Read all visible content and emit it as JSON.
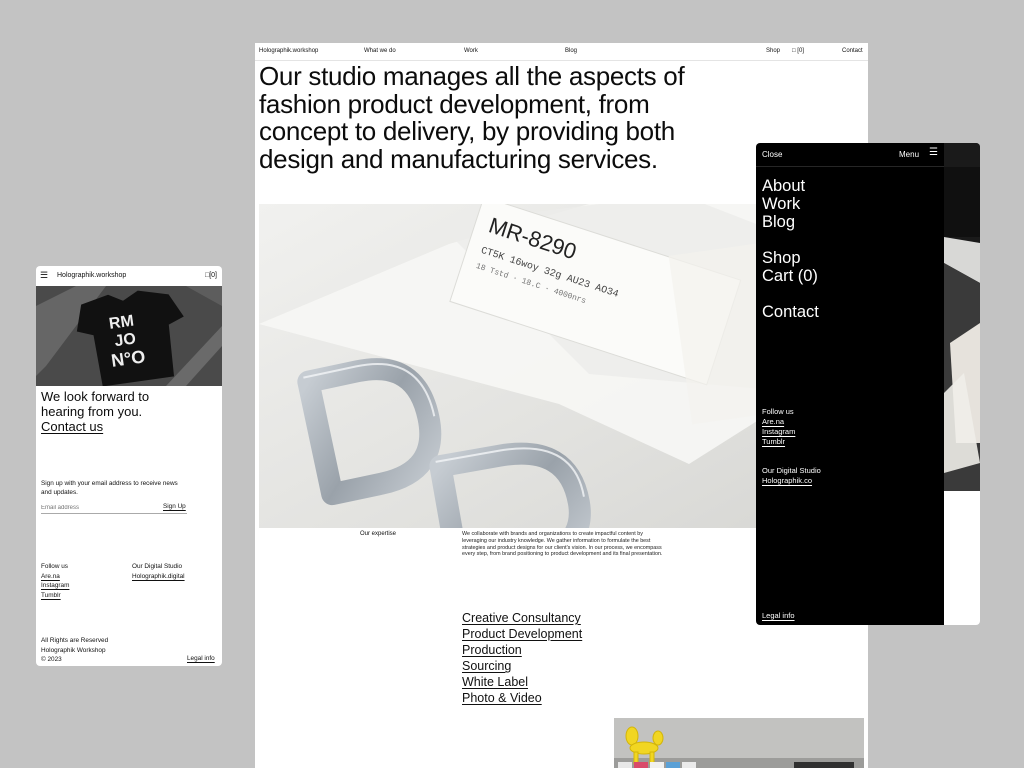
{
  "desktop": {
    "nav": {
      "brand": "Holographik.workshop",
      "what_we_do": "What we do",
      "work": "Work",
      "blog": "Blog",
      "shop": "Shop",
      "cart": "[0]",
      "contact": "Contact"
    },
    "hero_text": "Our studio manages all the aspects of fashion product development, from concept to delivery, by providing both design and manufacturing services.",
    "image_label_top": "MR-8290",
    "expertise": {
      "label": "Our expertise",
      "text": "We collaborate with brands and organizations to create impactful content by leveraging our industry knowledge. We gather information to formulate the best strategies and product designs for our client's vision. In our process, we encompass every step, from brand positioning to product development and its final presentation."
    },
    "services": [
      "Creative Consultancy",
      "Product Development",
      "Production",
      "Sourcing",
      "White Label",
      "Photo & Video"
    ]
  },
  "mobile": {
    "brand": "Holographik.workshop",
    "cart": "[0]",
    "headline_line1": "We look forward to",
    "headline_line2": "hearing from you.",
    "contact_link": "Contact us",
    "signup_text": "Sign up with your email address to receive news and updates.",
    "email_placeholder": "Email address",
    "signup_button": "Sign Up",
    "follow_label": "Follow us",
    "follow_links": [
      "Are.na",
      "Instagram",
      "Tumblr"
    ],
    "studio_label": "Our Digital Studio",
    "studio_link": "Holographik.digital",
    "rights_line1": "All Rights are Reserved",
    "rights_line2": "Holographik Workshop",
    "rights_line3": "© 2023",
    "legal": "Legal info"
  },
  "menu": {
    "close": "Close",
    "menu_label": "Menu",
    "primary": [
      "About",
      "Work",
      "Blog"
    ],
    "secondary": [
      "Shop",
      "Cart (0)"
    ],
    "contact": "Contact",
    "follow_label": "Follow us",
    "follow_links": [
      "Are.na",
      "Instagram",
      "Tumblr"
    ],
    "studio_label": "Our Digital Studio",
    "studio_link": "Holographik.co",
    "legal": "Legal info"
  }
}
